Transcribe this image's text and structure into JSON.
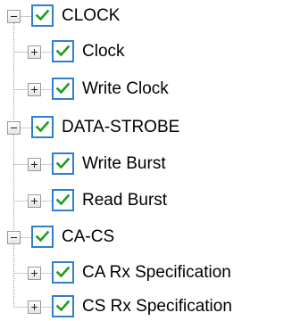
{
  "tree": {
    "nodes": [
      {
        "label": "CLOCK",
        "level": 0,
        "expanded": true,
        "checked": true
      },
      {
        "label": "Clock",
        "level": 1,
        "expanded": false,
        "checked": true
      },
      {
        "label": "Write Clock",
        "level": 1,
        "expanded": false,
        "checked": true
      },
      {
        "label": "DATA-STROBE",
        "level": 0,
        "expanded": true,
        "checked": true
      },
      {
        "label": "Write Burst",
        "level": 1,
        "expanded": false,
        "checked": true
      },
      {
        "label": "Read Burst",
        "level": 1,
        "expanded": false,
        "checked": true
      },
      {
        "label": "CA-CS",
        "level": 0,
        "expanded": true,
        "checked": true
      },
      {
        "label": "CA Rx Specification",
        "level": 1,
        "expanded": false,
        "checked": true
      },
      {
        "label": "CS Rx Specification",
        "level": 1,
        "expanded": false,
        "checked": true
      }
    ]
  },
  "colors": {
    "checkbox_border": "#2f7fd0",
    "checkmark": "#1f9c1f",
    "tree_line": "#9a9a9a"
  },
  "icons": {
    "expander_expanded": "minus-box-icon",
    "expander_collapsed": "plus-box-icon",
    "check": "checkmark-icon"
  }
}
